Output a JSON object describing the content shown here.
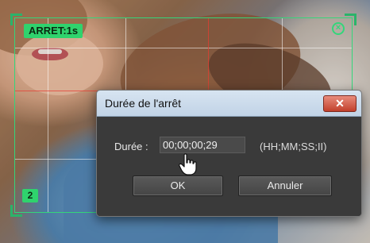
{
  "overlay": {
    "stop_tag": "ARRET:1s",
    "index_tag": "2",
    "accent_color": "#2fd36d"
  },
  "dialog": {
    "title": "Durée de l'arrêt",
    "close_label": "✕",
    "duration_label": "Durée :",
    "duration_value": "00;00;00;29",
    "format_hint": "(HH;MM;SS;II)",
    "ok_label": "OK",
    "cancel_label": "Annuler"
  },
  "icons": [
    "close-icon",
    "overlay-close-icon",
    "hand-cursor-icon"
  ]
}
